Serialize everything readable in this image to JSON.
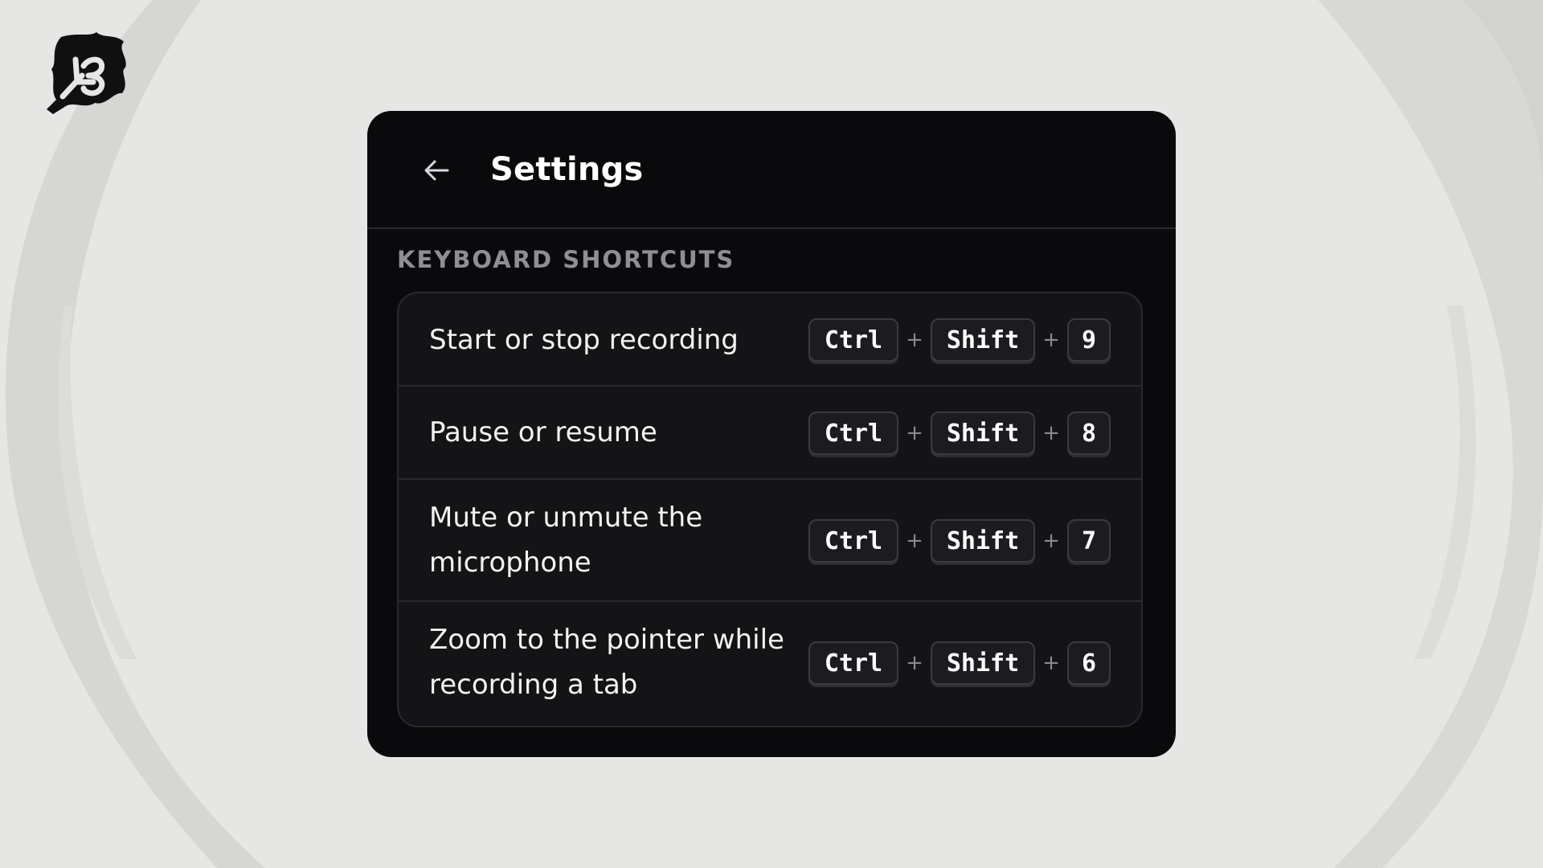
{
  "app": {
    "title": "Settings"
  },
  "colors": {
    "page_background": "#e6e6e4",
    "panel_background": "#0a0a0c",
    "list_background": "#141417",
    "text_primary": "#ffffff",
    "text_muted": "#8e8e94"
  },
  "icons": {
    "logo": "leaf-logo-icon",
    "back": "arrow-left-icon"
  },
  "section": {
    "label": "KEYBOARD SHORTCUTS"
  },
  "shortcuts": [
    {
      "label": "Start or stop recording",
      "keys": [
        "Ctrl",
        "Shift",
        "9"
      ]
    },
    {
      "label": "Pause or resume",
      "keys": [
        "Ctrl",
        "Shift",
        "8"
      ]
    },
    {
      "label": "Mute or unmute the microphone",
      "keys": [
        "Ctrl",
        "Shift",
        "7"
      ]
    },
    {
      "label": "Zoom to the pointer while recording a tab",
      "keys": [
        "Ctrl",
        "Shift",
        "6"
      ]
    }
  ],
  "separator": "+"
}
